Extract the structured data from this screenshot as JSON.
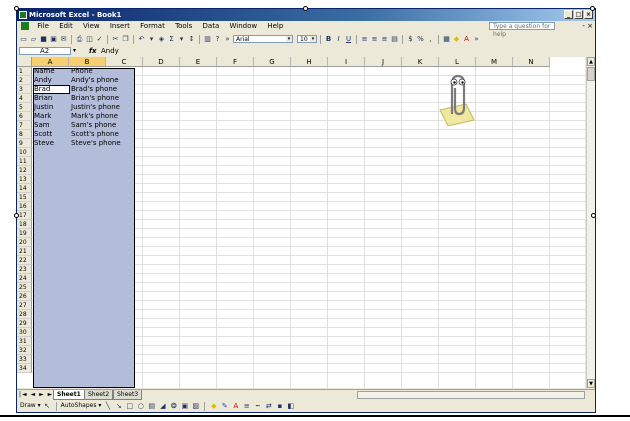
{
  "window": {
    "title": "Microsoft Excel - Book1",
    "minimize": "_",
    "restore": "□",
    "close": "×"
  },
  "menubar": {
    "items": [
      "File",
      "Edit",
      "View",
      "Insert",
      "Format",
      "Tools",
      "Data",
      "Window",
      "Help"
    ],
    "ask_placeholder": "Type a question for help",
    "doc_controls": "- ×"
  },
  "toolbar": {
    "font": "Arial",
    "size": "10",
    "bold": "B",
    "italic": "I",
    "underline": "U",
    "currency": "$",
    "percent": "%",
    "comma": ","
  },
  "formula_bar": {
    "name_box": "A2",
    "fx": "fx",
    "content": "Andy"
  },
  "columns": [
    "A",
    "B",
    "C",
    "D",
    "E",
    "F",
    "G",
    "H",
    "I",
    "J",
    "K",
    "L",
    "M",
    "N"
  ],
  "rows": [
    "1",
    "2",
    "3",
    "4",
    "5",
    "6",
    "7",
    "8",
    "9",
    "10",
    "11",
    "12",
    "13",
    "14",
    "15",
    "16",
    "17",
    "18",
    "19",
    "20",
    "21",
    "22",
    "23",
    "24",
    "25",
    "26",
    "27",
    "28",
    "29",
    "30",
    "31",
    "32",
    "33",
    "34"
  ],
  "cells": {
    "a": [
      "Name",
      "Andy",
      "Brad",
      "Brian",
      "Justin",
      "Mark",
      "Sam",
      "Scott",
      "Steve"
    ],
    "b": [
      "Phone",
      "Andy's phone",
      "Brad's phone",
      "Brian's phone",
      "Justin's phone",
      "Mark's phone",
      "Sam's phone",
      "Scott's phone",
      "Steve's phone"
    ]
  },
  "sheets": [
    "Sheet1",
    "Sheet2",
    "Sheet3"
  ],
  "tab_nav": "|◄ ◄ ► ►|",
  "drawbar": {
    "draw": "Draw ▾",
    "autoshapes": "AutoShapes ▾"
  },
  "colors": {
    "selection": "#b3bcd9",
    "title_start": "#0a246a",
    "chrome": "#ece9d8"
  },
  "icons": [
    "excel-app-icon",
    "new-icon",
    "open-icon",
    "save-icon",
    "print-icon",
    "spelling-icon",
    "cut-icon",
    "copy-icon",
    "undo-icon",
    "autosum-icon",
    "sort-icon",
    "chart-icon",
    "help-icon",
    "office-assistant-clippy"
  ]
}
